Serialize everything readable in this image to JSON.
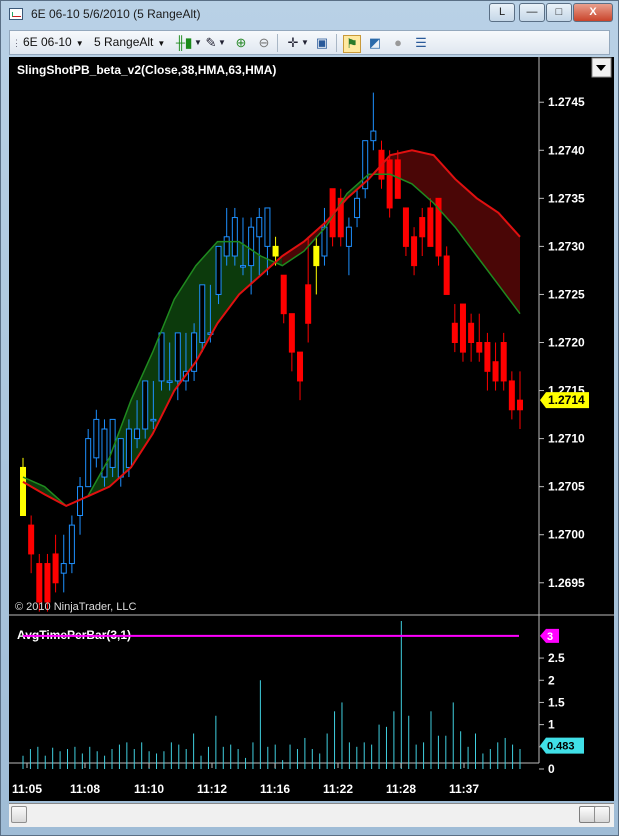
{
  "window": {
    "title": "6E 06-10  5/6/2010 (5 RangeAlt)",
    "btn_l": "L",
    "btn_min": "—",
    "btn_max": "□",
    "btn_close": "X"
  },
  "toolbar": {
    "instrument": "6E 06-10",
    "period": "5 RangeAlt"
  },
  "price_panel": {
    "title": "SlingShotPB_beta_v2(Close,38,HMA,63,HMA)",
    "copyright": "© 2010 NinjaTrader, LLC",
    "axis_ticks": [
      "1.2745",
      "1.2740",
      "1.2735",
      "1.2730",
      "1.2725",
      "1.2720",
      "1.2715",
      "1.2710",
      "1.2705",
      "1.2700",
      "1.2695"
    ],
    "last_price": "1.2714",
    "colors": {
      "up": "#1e90ff",
      "down": "#ff0000",
      "neutral": "#ffff00",
      "fast_line": "#e01010",
      "slow_line": "#1f8a1f"
    }
  },
  "indicator_panel": {
    "title": "AvgTimePerBar(3,1)",
    "axis_ticks": [
      "3",
      "2.5",
      "2",
      "1.5",
      "1",
      "0.5",
      "0"
    ],
    "marker_value": "3",
    "last_value": "0.483",
    "colors": {
      "line": "#ff00ff",
      "bars": "#40d0e0"
    }
  },
  "time_axis": [
    "11:05",
    "11:08",
    "11:10",
    "11:12",
    "11:16",
    "11:22",
    "11:28",
    "11:37"
  ],
  "chart_data": {
    "type": "candlestick",
    "title": "SlingShotPB_beta_v2(Close,38,HMA,63,HMA)",
    "ylim": [
      1.2692,
      1.2748
    ],
    "bars": [
      {
        "o": 1.2707,
        "h": 1.2708,
        "l": 1.2702,
        "c": 1.2702,
        "col": "neutral"
      },
      {
        "o": 1.2701,
        "h": 1.2702,
        "l": 1.2696,
        "c": 1.2698,
        "col": "down"
      },
      {
        "o": 1.2697,
        "h": 1.2698,
        "l": 1.2692,
        "c": 1.2693,
        "col": "down"
      },
      {
        "o": 1.2697,
        "h": 1.2698,
        "l": 1.2692,
        "c": 1.2693,
        "col": "down"
      },
      {
        "o": 1.2698,
        "h": 1.27,
        "l": 1.2694,
        "c": 1.2695,
        "col": "down"
      },
      {
        "o": 1.2697,
        "h": 1.27,
        "l": 1.2694,
        "c": 1.2696,
        "col": "up"
      },
      {
        "o": 1.2697,
        "h": 1.2702,
        "l": 1.2696,
        "c": 1.2701,
        "col": "up"
      },
      {
        "o": 1.2702,
        "h": 1.2706,
        "l": 1.27,
        "c": 1.2705,
        "col": "up"
      },
      {
        "o": 1.2705,
        "h": 1.2711,
        "l": 1.2705,
        "c": 1.271,
        "col": "up"
      },
      {
        "o": 1.2708,
        "h": 1.2713,
        "l": 1.2707,
        "c": 1.2712,
        "col": "up"
      },
      {
        "o": 1.2711,
        "h": 1.2712,
        "l": 1.2705,
        "c": 1.2706,
        "col": "up"
      },
      {
        "o": 1.2707,
        "h": 1.2712,
        "l": 1.2706,
        "c": 1.2712,
        "col": "up"
      },
      {
        "o": 1.271,
        "h": 1.271,
        "l": 1.2705,
        "c": 1.2706,
        "col": "up"
      },
      {
        "o": 1.2707,
        "h": 1.2712,
        "l": 1.2706,
        "c": 1.2711,
        "col": "up"
      },
      {
        "o": 1.2711,
        "h": 1.2714,
        "l": 1.2709,
        "c": 1.271,
        "col": "up"
      },
      {
        "o": 1.2711,
        "h": 1.2716,
        "l": 1.271,
        "c": 1.2716,
        "col": "up"
      },
      {
        "o": 1.2712,
        "h": 1.2716,
        "l": 1.2711,
        "c": 1.2712,
        "col": "up"
      },
      {
        "o": 1.2716,
        "h": 1.2721,
        "l": 1.2715,
        "c": 1.2721,
        "col": "up"
      },
      {
        "o": 1.2716,
        "h": 1.272,
        "l": 1.2715,
        "c": 1.2716,
        "col": "up"
      },
      {
        "o": 1.2716,
        "h": 1.2721,
        "l": 1.2714,
        "c": 1.2721,
        "col": "up"
      },
      {
        "o": 1.2716,
        "h": 1.2721,
        "l": 1.2715,
        "c": 1.2717,
        "col": "up"
      },
      {
        "o": 1.2717,
        "h": 1.2722,
        "l": 1.2716,
        "c": 1.2721,
        "col": "up"
      },
      {
        "o": 1.272,
        "h": 1.2726,
        "l": 1.2719,
        "c": 1.2726,
        "col": "up"
      },
      {
        "o": 1.2721,
        "h": 1.2726,
        "l": 1.272,
        "c": 1.2721,
        "col": "up"
      },
      {
        "o": 1.2725,
        "h": 1.273,
        "l": 1.2724,
        "c": 1.273,
        "col": "up"
      },
      {
        "o": 1.2731,
        "h": 1.2734,
        "l": 1.2728,
        "c": 1.2729,
        "col": "up"
      },
      {
        "o": 1.2729,
        "h": 1.2734,
        "l": 1.2728,
        "c": 1.2733,
        "col": "up"
      },
      {
        "o": 1.2728,
        "h": 1.2733,
        "l": 1.2727,
        "c": 1.2728,
        "col": "up"
      },
      {
        "o": 1.2728,
        "h": 1.2733,
        "l": 1.2725,
        "c": 1.2732,
        "col": "up"
      },
      {
        "o": 1.2733,
        "h": 1.2734,
        "l": 1.2727,
        "c": 1.2731,
        "col": "up"
      },
      {
        "o": 1.2734,
        "h": 1.2734,
        "l": 1.2727,
        "c": 1.273,
        "col": "up"
      },
      {
        "o": 1.273,
        "h": 1.2731,
        "l": 1.2728,
        "c": 1.2729,
        "col": "neutral"
      },
      {
        "o": 1.2727,
        "h": 1.2727,
        "l": 1.2722,
        "c": 1.2723,
        "col": "down"
      },
      {
        "o": 1.2723,
        "h": 1.2723,
        "l": 1.2717,
        "c": 1.2719,
        "col": "down"
      },
      {
        "o": 1.2719,
        "h": 1.2719,
        "l": 1.2714,
        "c": 1.2716,
        "col": "down"
      },
      {
        "o": 1.2726,
        "h": 1.2731,
        "l": 1.272,
        "c": 1.2722,
        "col": "down"
      },
      {
        "o": 1.2728,
        "h": 1.2731,
        "l": 1.2725,
        "c": 1.273,
        "col": "neutral"
      },
      {
        "o": 1.2729,
        "h": 1.2734,
        "l": 1.2728,
        "c": 1.2732,
        "col": "up"
      },
      {
        "o": 1.2736,
        "h": 1.2736,
        "l": 1.273,
        "c": 1.2731,
        "col": "down"
      },
      {
        "o": 1.2735,
        "h": 1.2736,
        "l": 1.273,
        "c": 1.2731,
        "col": "down"
      },
      {
        "o": 1.273,
        "h": 1.2733,
        "l": 1.2727,
        "c": 1.2732,
        "col": "up"
      },
      {
        "o": 1.2733,
        "h": 1.2736,
        "l": 1.2732,
        "c": 1.2735,
        "col": "up"
      },
      {
        "o": 1.2741,
        "h": 1.2741,
        "l": 1.2735,
        "c": 1.2736,
        "col": "up"
      },
      {
        "o": 1.2741,
        "h": 1.2746,
        "l": 1.274,
        "c": 1.2742,
        "col": "up"
      },
      {
        "o": 1.274,
        "h": 1.2741,
        "l": 1.2736,
        "c": 1.2737,
        "col": "down"
      },
      {
        "o": 1.2739,
        "h": 1.274,
        "l": 1.2733,
        "c": 1.2734,
        "col": "down"
      },
      {
        "o": 1.2739,
        "h": 1.274,
        "l": 1.2735,
        "c": 1.2735,
        "col": "down"
      },
      {
        "o": 1.2734,
        "h": 1.2734,
        "l": 1.2729,
        "c": 1.273,
        "col": "down"
      },
      {
        "o": 1.2731,
        "h": 1.2732,
        "l": 1.2727,
        "c": 1.2728,
        "col": "down"
      },
      {
        "o": 1.2733,
        "h": 1.2734,
        "l": 1.2729,
        "c": 1.2731,
        "col": "down"
      },
      {
        "o": 1.2734,
        "h": 1.2735,
        "l": 1.273,
        "c": 1.273,
        "col": "down"
      },
      {
        "o": 1.2735,
        "h": 1.2735,
        "l": 1.2728,
        "c": 1.2729,
        "col": "down"
      },
      {
        "o": 1.2729,
        "h": 1.273,
        "l": 1.2725,
        "c": 1.2725,
        "col": "down"
      },
      {
        "o": 1.2722,
        "h": 1.2724,
        "l": 1.2719,
        "c": 1.272,
        "col": "down"
      },
      {
        "o": 1.2724,
        "h": 1.2724,
        "l": 1.2718,
        "c": 1.2719,
        "col": "down"
      },
      {
        "o": 1.2722,
        "h": 1.2723,
        "l": 1.2718,
        "c": 1.272,
        "col": "down"
      },
      {
        "o": 1.272,
        "h": 1.2723,
        "l": 1.2718,
        "c": 1.2719,
        "col": "down"
      },
      {
        "o": 1.272,
        "h": 1.2721,
        "l": 1.2715,
        "c": 1.2717,
        "col": "down"
      },
      {
        "o": 1.2718,
        "h": 1.272,
        "l": 1.2715,
        "c": 1.2716,
        "col": "down"
      },
      {
        "o": 1.272,
        "h": 1.2721,
        "l": 1.2715,
        "c": 1.2716,
        "col": "down"
      },
      {
        "o": 1.2716,
        "h": 1.2717,
        "l": 1.2712,
        "c": 1.2713,
        "col": "down"
      },
      {
        "o": 1.2714,
        "h": 1.2717,
        "l": 1.2711,
        "c": 1.2713,
        "col": "down"
      }
    ],
    "fast_line": [
      1.27055,
      1.27042,
      1.2703,
      1.2704,
      1.2705,
      1.2707,
      1.27105,
      1.2715,
      1.2718,
      1.2722,
      1.2725,
      1.2727,
      1.2729,
      1.27305,
      1.27325,
      1.2735,
      1.2737,
      1.27395,
      1.274,
      1.27395,
      1.2737,
      1.2735,
      1.27335,
      1.2731
    ],
    "slow_line": [
      1.2706,
      1.2705,
      1.2703,
      1.2704,
      1.2708,
      1.2714,
      1.2719,
      1.27245,
      1.2728,
      1.27305,
      1.27305,
      1.2729,
      1.2728,
      1.27295,
      1.2732,
      1.27355,
      1.27375,
      1.27375,
      1.27365,
      1.27345,
      1.2732,
      1.2729,
      1.2726,
      1.2723
    ],
    "time_ticks": [
      "11:05",
      "11:08",
      "11:10",
      "11:12",
      "11:16",
      "11:22",
      "11:28",
      "11:37"
    ],
    "indicator": {
      "name": "AvgTimePerBar(3,1)",
      "ylim": [
        0,
        3.2
      ],
      "line_value": 3,
      "last_value": 0.483,
      "values": [
        0.3,
        0.45,
        0.5,
        0.3,
        0.48,
        0.4,
        0.45,
        0.5,
        0.35,
        0.5,
        0.4,
        0.3,
        0.45,
        0.55,
        0.6,
        0.45,
        0.6,
        0.4,
        0.35,
        0.4,
        0.6,
        0.55,
        0.45,
        0.8,
        0.3,
        0.5,
        1.2,
        0.5,
        0.55,
        0.45,
        0.25,
        0.6,
        2.0,
        0.5,
        0.55,
        0.2,
        0.55,
        0.45,
        0.7,
        0.45,
        0.35,
        0.8,
        1.3,
        1.5,
        0.6,
        0.5,
        0.6,
        0.55,
        1.0,
        0.95,
        1.3,
        3.4,
        1.2,
        0.55,
        0.6,
        1.3,
        0.75,
        0.75,
        1.5,
        0.85,
        0.5,
        0.8,
        0.35,
        0.45,
        0.6,
        0.7,
        0.55,
        0.45
      ]
    }
  }
}
